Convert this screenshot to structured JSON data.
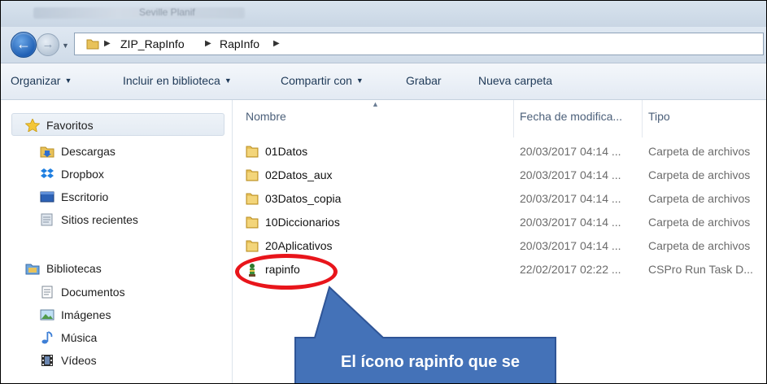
{
  "window": {
    "title_text": "Seville Planif"
  },
  "nav": {
    "breadcrumbs": [
      "ZIP_RapInfo",
      "RapInfo"
    ]
  },
  "toolbar": {
    "organize_label": "Organizar",
    "include_label": "Incluir en biblioteca",
    "share_label": "Compartir con",
    "burn_label": "Grabar",
    "new_folder_label": "Nueva carpeta"
  },
  "sidebar": {
    "favorites": {
      "label": "Favoritos",
      "items": [
        {
          "label": "Descargas",
          "icon": "downloads-folder-icon"
        },
        {
          "label": "Dropbox",
          "icon": "dropbox-icon"
        },
        {
          "label": "Escritorio",
          "icon": "desktop-icon"
        },
        {
          "label": "Sitios recientes",
          "icon": "recent-places-icon"
        }
      ]
    },
    "libraries": {
      "label": "Bibliotecas",
      "items": [
        {
          "label": "Documentos",
          "icon": "document-icon"
        },
        {
          "label": "Imágenes",
          "icon": "images-icon"
        },
        {
          "label": "Música",
          "icon": "music-icon"
        },
        {
          "label": "Vídeos",
          "icon": "video-icon"
        }
      ]
    }
  },
  "columns": {
    "name": "Nombre",
    "date": "Fecha de modifica...",
    "type": "Tipo"
  },
  "files": [
    {
      "name": "01Datos",
      "date": "20/03/2017 04:14 ...",
      "type": "Carpeta de archivos",
      "icon": "folder-icon"
    },
    {
      "name": "02Datos_aux",
      "date": "20/03/2017 04:14 ...",
      "type": "Carpeta de archivos",
      "icon": "folder-icon"
    },
    {
      "name": "03Datos_copia",
      "date": "20/03/2017 04:14 ...",
      "type": "Carpeta de archivos",
      "icon": "folder-icon"
    },
    {
      "name": "10Diccionarios",
      "date": "20/03/2017 04:14 ...",
      "type": "Carpeta de archivos",
      "icon": "folder-icon"
    },
    {
      "name": "20Aplicativos",
      "date": "20/03/2017 04:14 ...",
      "type": "Carpeta de archivos",
      "icon": "folder-icon"
    },
    {
      "name": "rapinfo",
      "date": "22/02/2017 02:22 ...",
      "type": "CSPro Run Task D...",
      "icon": "cspro-run-icon"
    }
  ],
  "annotation": {
    "callout_text": "El ícono rapinfo que se",
    "ring_color": "#e8151b",
    "callout_color": "#4472b8"
  }
}
